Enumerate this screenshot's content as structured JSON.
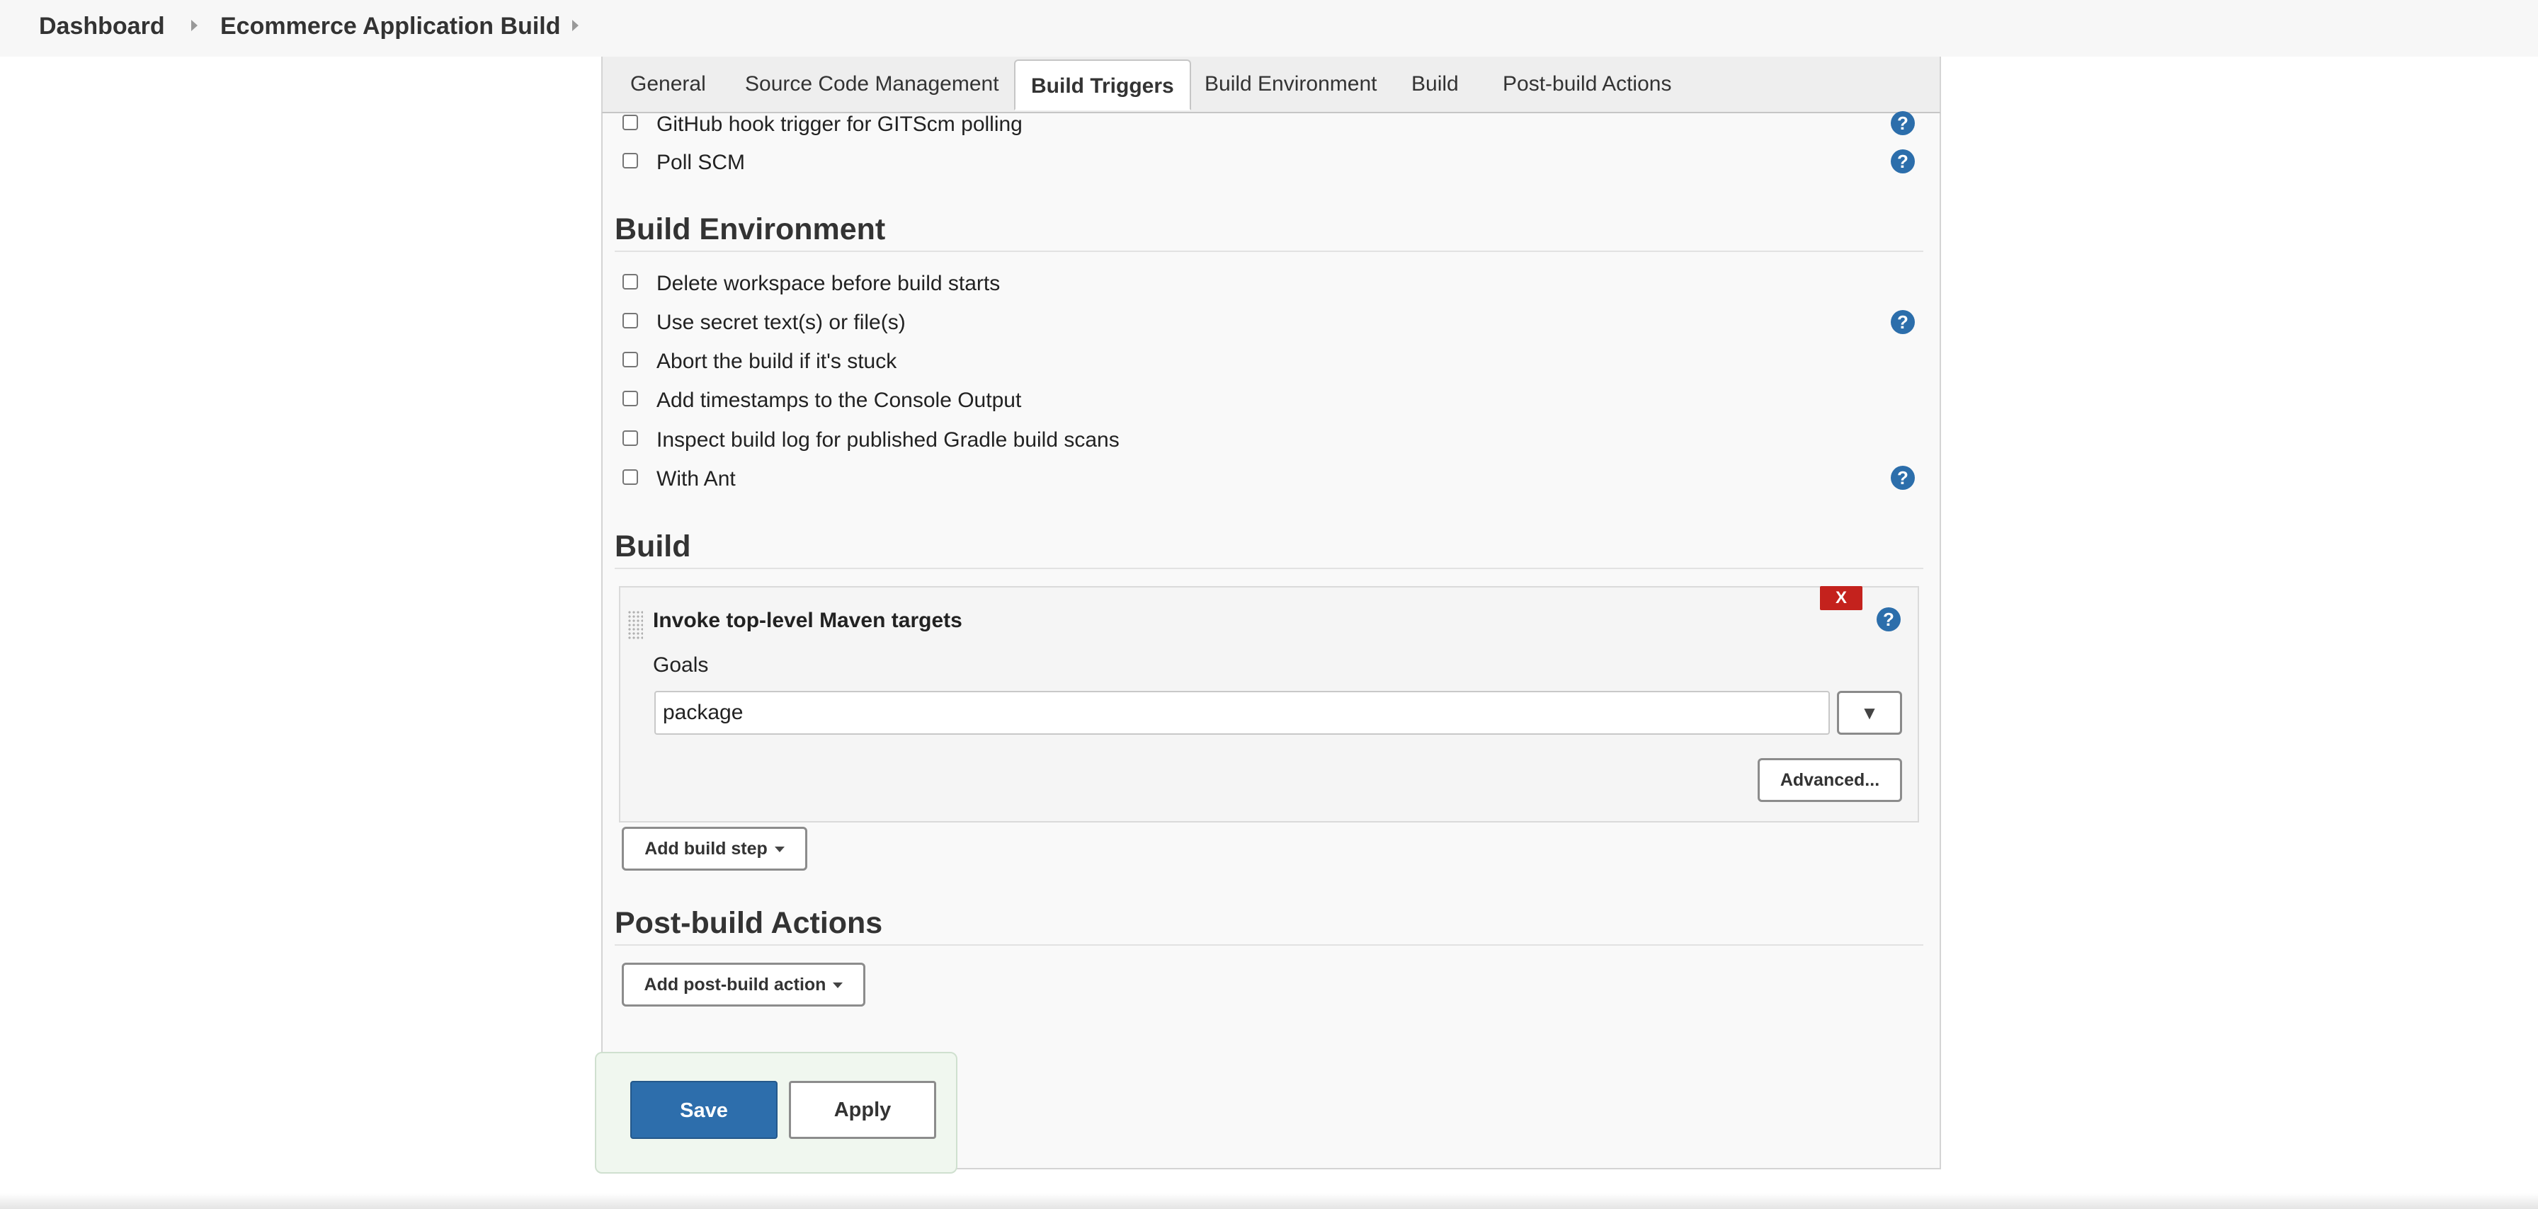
{
  "breadcrumb": {
    "items": [
      "Dashboard",
      "Ecommerce Application Build"
    ]
  },
  "tabs": [
    {
      "label": "General"
    },
    {
      "label": "Source Code Management"
    },
    {
      "label": "Build Triggers",
      "active": true
    },
    {
      "label": "Build Environment"
    },
    {
      "label": "Build"
    },
    {
      "label": "Post-build Actions"
    }
  ],
  "build_triggers": {
    "options": [
      {
        "label": "GitHub hook trigger for GITScm polling",
        "checked": false,
        "has_help": true
      },
      {
        "label": "Poll SCM",
        "checked": false,
        "has_help": true
      }
    ]
  },
  "build_environment": {
    "title": "Build Environment",
    "options": [
      {
        "label": "Delete workspace before build starts",
        "checked": false,
        "has_help": false
      },
      {
        "label": "Use secret text(s) or file(s)",
        "checked": false,
        "has_help": true
      },
      {
        "label": "Abort the build if it's stuck",
        "checked": false,
        "has_help": false
      },
      {
        "label": "Add timestamps to the Console Output",
        "checked": false,
        "has_help": false
      },
      {
        "label": "Inspect build log for published Gradle build scans",
        "checked": false,
        "has_help": false
      },
      {
        "label": "With Ant",
        "checked": false,
        "has_help": true
      }
    ]
  },
  "build": {
    "title": "Build",
    "step": {
      "title": "Invoke top-level Maven targets",
      "delete_label": "X",
      "goals_label": "Goals",
      "goals_value": "package",
      "expand_label": "▼",
      "advanced_label": "Advanced..."
    },
    "add_step_label": "Add build step"
  },
  "post_build": {
    "title": "Post-build Actions",
    "add_action_label": "Add post-build action"
  },
  "footer": {
    "save_label": "Save",
    "apply_label": "Apply"
  },
  "help_glyph": "?",
  "colors": {
    "primary_button": "#2d6eac",
    "help_icon": "#2c6eab",
    "delete_button": "#c4221d",
    "save_bar": "#f0f7ef"
  }
}
